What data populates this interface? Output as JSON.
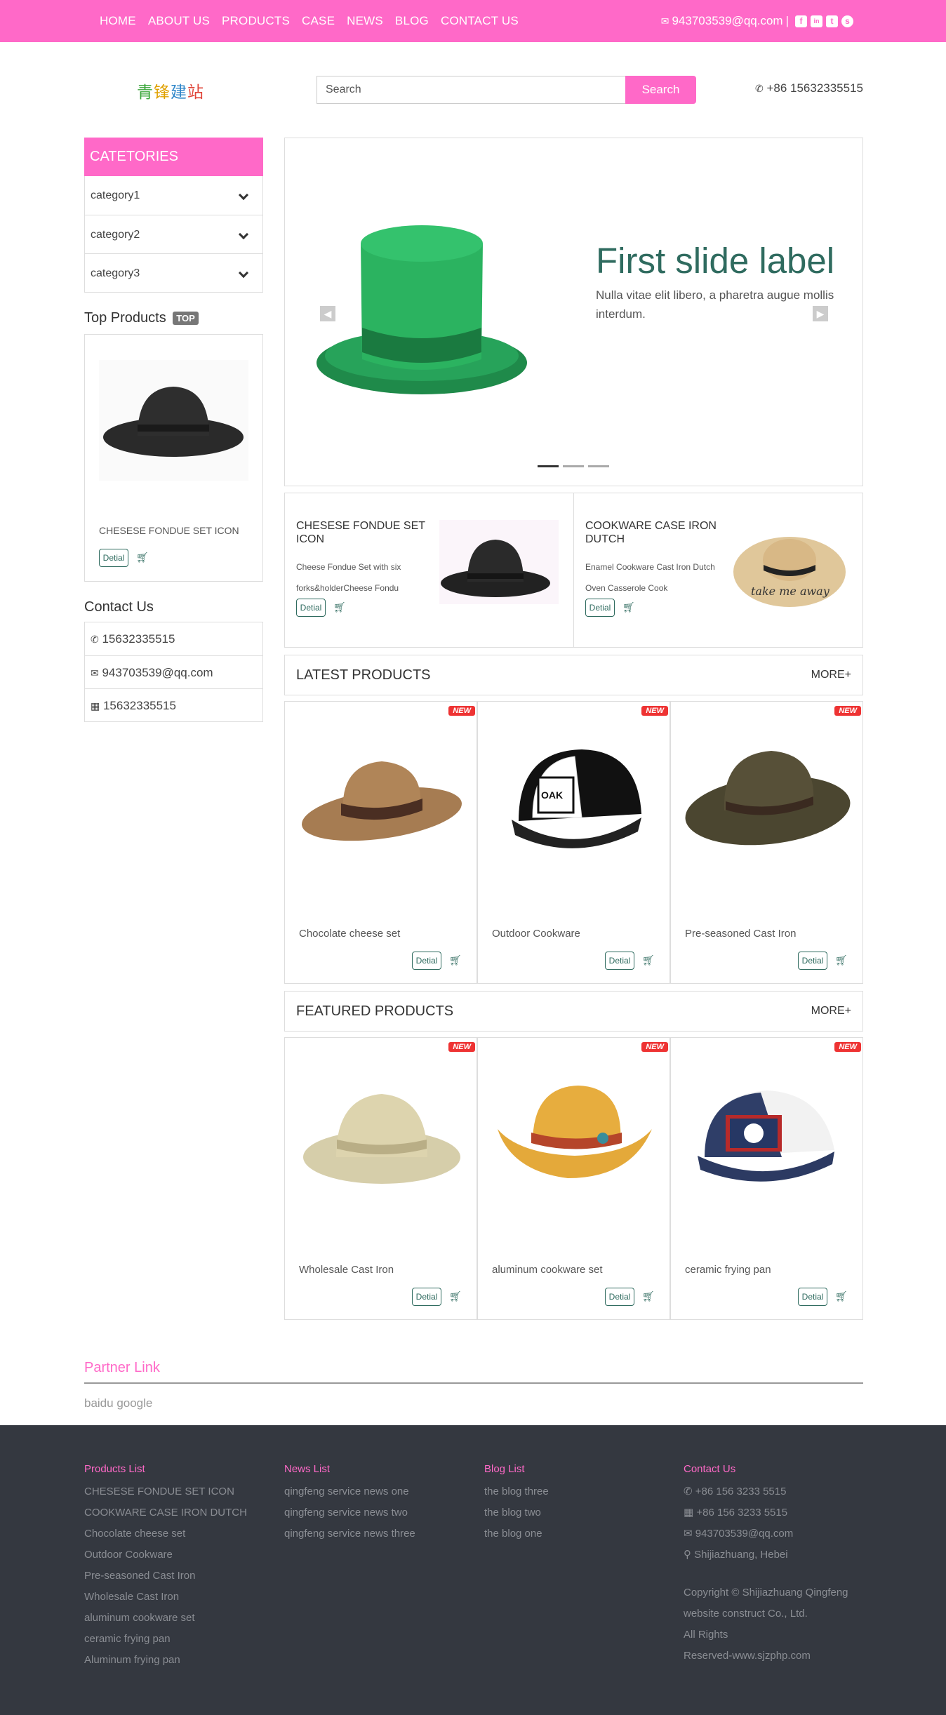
{
  "nav": {
    "items": [
      "HOME",
      "ABOUT US",
      "PRODUCTS",
      "CASE",
      "NEWS",
      "BLOG",
      "CONTACT US"
    ]
  },
  "top_contact": {
    "email": "943703539@qq.com",
    "separator": "|",
    "social": [
      "f",
      "in",
      "t",
      "s"
    ]
  },
  "logo": {
    "text": "青锋建站"
  },
  "search": {
    "placeholder": "Search",
    "button": "Search"
  },
  "header_phone": "+86 15632335515",
  "categories": {
    "title": "CATETORIES",
    "items": [
      "category1",
      "category2",
      "category3"
    ]
  },
  "top_products": {
    "title": "Top Products",
    "badge": "TOP",
    "item": {
      "name": "CHESESE FONDUE SET ICON",
      "detail": "Detial"
    }
  },
  "contact_us": {
    "title": "Contact Us",
    "items": [
      "15632335515",
      "943703539@qq.com",
      "15632335515"
    ]
  },
  "slider": {
    "title": "First slide label",
    "text": "Nulla vitae elit libero, a pharetra augue mollis interdum.",
    "indicators": 3,
    "active_indicator": 1
  },
  "featured_top": [
    {
      "title": "CHESESE FONDUE SET ICON",
      "desc": "Cheese Fondue Set with six forks&holderCheese Fondu",
      "detail": "Detial"
    },
    {
      "title": "COOKWARE CASE IRON DUTCH",
      "desc": "Enamel Cookware Cast Iron Dutch Oven Casserole Cook",
      "detail": "Detial"
    }
  ],
  "latest": {
    "title": "LATEST PRODUCTS",
    "more": "MORE+",
    "items": [
      {
        "name": "Chocolate cheese set",
        "badge": "NEW",
        "detail": "Detial"
      },
      {
        "name": "Outdoor Cookware",
        "badge": "NEW",
        "detail": "Detial"
      },
      {
        "name": "Pre-seasoned Cast Iron",
        "badge": "NEW",
        "detail": "Detial"
      }
    ]
  },
  "featured": {
    "title": "FEATURED PRODUCTS",
    "more": "MORE+",
    "items": [
      {
        "name": "Wholesale Cast Iron",
        "badge": "NEW",
        "detail": "Detial"
      },
      {
        "name": "aluminum cookware set",
        "badge": "NEW",
        "detail": "Detial"
      },
      {
        "name": "ceramic frying pan",
        "badge": "NEW",
        "detail": "Detial"
      }
    ]
  },
  "partner": {
    "title": "Partner Link",
    "links": "baidu google"
  },
  "footer": {
    "products": {
      "title": "Products List",
      "items": [
        "CHESESE FONDUE SET ICON",
        "COOKWARE CASE IRON DUTCH",
        "Chocolate cheese set",
        "Outdoor Cookware",
        "Pre-seasoned Cast Iron",
        "Wholesale Cast Iron",
        "aluminum cookware set",
        "ceramic frying pan",
        "Aluminum frying pan"
      ]
    },
    "news": {
      "title": "News List",
      "items": [
        "qingfeng service news one",
        "qingfeng service news two",
        "qingfeng service news three"
      ]
    },
    "blog": {
      "title": "Blog List",
      "items": [
        "the blog three",
        "the blog two",
        "the blog one"
      ]
    },
    "contact": {
      "title": "Contact Us",
      "items": [
        "+86 156 3233 5515",
        "+86 156 3233 5515",
        "943703539@qq.com",
        "Shijiazhuang, Hebei"
      ],
      "copyright": [
        "Copyright © Shijiazhuang Qingfeng",
        "website construct Co., Ltd.",
        "All Rights",
        "Reserved-www.sjzphp.com"
      ]
    }
  },
  "colors": {
    "brand": "#ff69c8",
    "accent": "#2f6b5f",
    "footer_bg": "#343840",
    "new_badge": "#e33333"
  }
}
